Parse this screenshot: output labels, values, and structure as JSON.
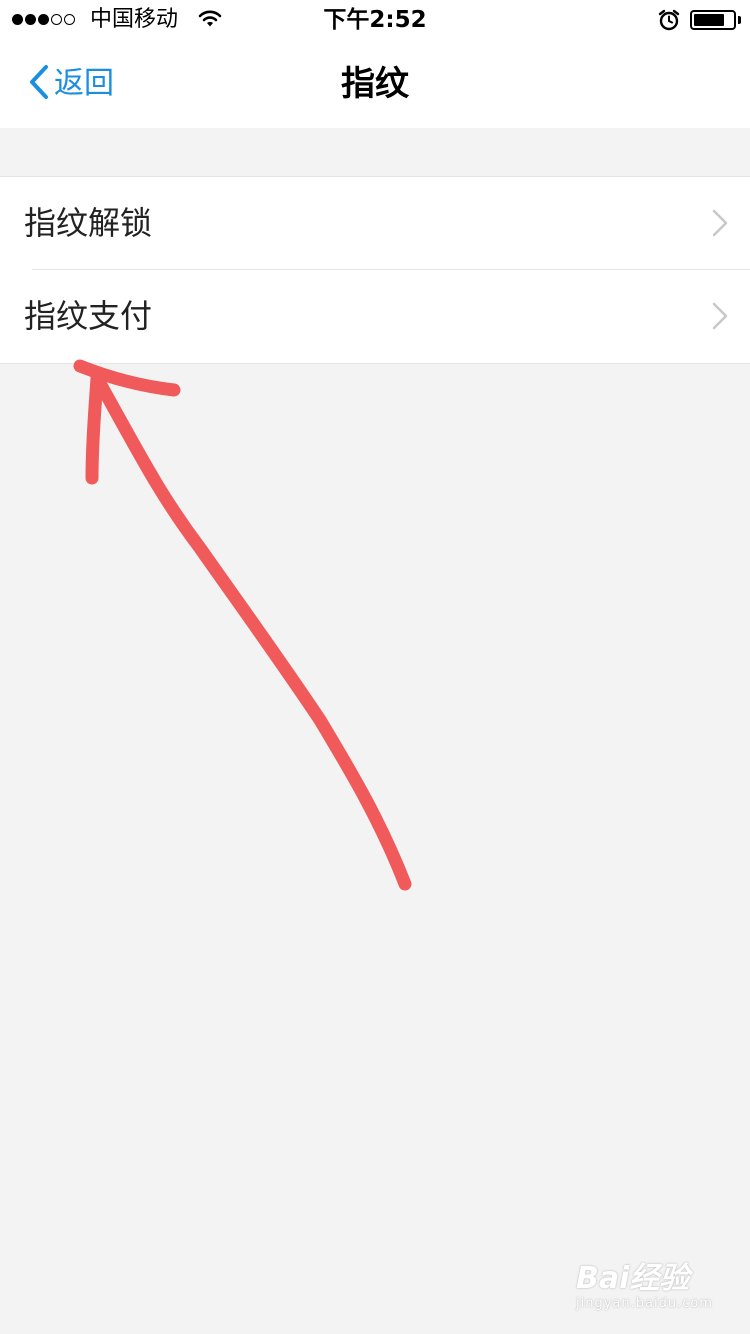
{
  "status_bar": {
    "carrier": "中国移动",
    "time": "下午2:52",
    "signal_full": 3,
    "signal_empty": 2,
    "battery_level": 0.8
  },
  "nav": {
    "back_label": "返回",
    "title": "指纹",
    "accent_color": "#1a8fe0"
  },
  "settings": {
    "items": [
      {
        "label": "指纹解锁",
        "icon": "chevron-right-icon"
      },
      {
        "label": "指纹支付",
        "icon": "chevron-right-icon"
      }
    ]
  },
  "annotation": {
    "color": "#f05a5a",
    "icon": "red-arrow-annotation"
  },
  "watermark": {
    "brand": "Bai经验",
    "url": "jingyan.baidu.com"
  }
}
